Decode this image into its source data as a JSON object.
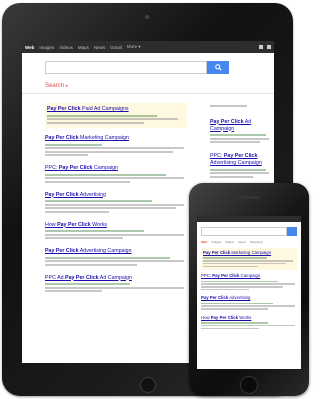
{
  "tablet": {
    "gbar": {
      "items": [
        "Web",
        "Images",
        "Videos",
        "Maps",
        "News",
        "Gmail",
        "More ▾"
      ]
    },
    "search_label": "Search",
    "results": [
      {
        "bold": "Pay Per Click",
        "rest": " Paid Ad Campaigns",
        "ad": true
      },
      {
        "bold": "Pay Per Click",
        "rest": " Marketing Campaign",
        "ad": false
      },
      {
        "prefix": "PPC: ",
        "bold": "Pay Per Click",
        "rest": " Campaign",
        "ad": false
      },
      {
        "bold": "Pay Per Click",
        "rest": " Advertising",
        "ad": false
      },
      {
        "prefix": "How ",
        "bold": "Pay Per Click",
        "rest": " Works",
        "ad": false
      },
      {
        "bold": "Pay Per Click",
        "rest": " Advertising Campaign",
        "ad": false
      },
      {
        "prefix": "PPC Ad ",
        "bold": "Pay Per Click",
        "rest": " Ad Campaign",
        "ad": false
      }
    ],
    "side_results": [
      {
        "bold": "Pay Per Click",
        "rest": " Ad Campaign"
      },
      {
        "prefix": "PPC: ",
        "bold": "Pay Per Click",
        "rest": " Advertising Campaign"
      }
    ]
  },
  "phone": {
    "tabs": [
      "Web",
      "Images",
      "Videos",
      "News",
      "Shopping"
    ],
    "results": [
      {
        "bold": "Pay Per Click",
        "rest": " Marketing Campaign",
        "ad": true
      },
      {
        "prefix": "PPC: ",
        "bold": "Pay Per Click",
        "rest": " Campaign",
        "ad": false
      },
      {
        "bold": "Pay Per Click",
        "rest": " Advertising",
        "ad": false
      },
      {
        "prefix": "How ",
        "bold": "Pay Per Click",
        "rest": " Works",
        "ad": false
      }
    ]
  },
  "colors": {
    "link": "#1a0dab",
    "url": "#006621",
    "accent": "#dd4b39",
    "button": "#4787ed",
    "ad_bg": "#fff8e1"
  }
}
